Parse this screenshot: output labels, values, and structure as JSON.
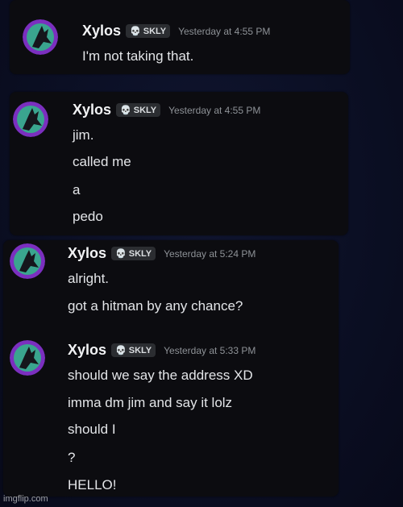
{
  "messages": [
    {
      "author": "Xylos",
      "tag": "SKLY",
      "timestamp": "Yesterday at 4:55 PM",
      "lines": [
        "I'm not taking that."
      ]
    },
    {
      "author": "Xylos",
      "tag": "SKLY",
      "timestamp": "Yesterday at 4:55 PM",
      "lines": [
        "jim.",
        "called me",
        "a",
        "pedo"
      ]
    },
    {
      "author": "Xylos",
      "tag": "SKLY",
      "timestamp": "Yesterday at 5:24 PM",
      "lines": [
        "alright.",
        "got a hitman by any chance?"
      ]
    },
    {
      "author": "Xylos",
      "tag": "SKLY",
      "timestamp": "Yesterday at 5:33 PM",
      "lines": [
        "should we say the address XD",
        "imma dm jim and say it lolz",
        "should I",
        "?",
        "HELLO!"
      ]
    }
  ],
  "watermark": "imgflip.com",
  "colors": {
    "background": "#0b0f24",
    "card": "#0c0c10",
    "username": "#f2f3f5",
    "timestamp": "#8e9297",
    "text": "#e3e5e8",
    "avatar_ring": "#7b2fbf",
    "avatar_fill": "#3aa58f"
  },
  "icons": {
    "tag_icon": "skull-icon"
  }
}
